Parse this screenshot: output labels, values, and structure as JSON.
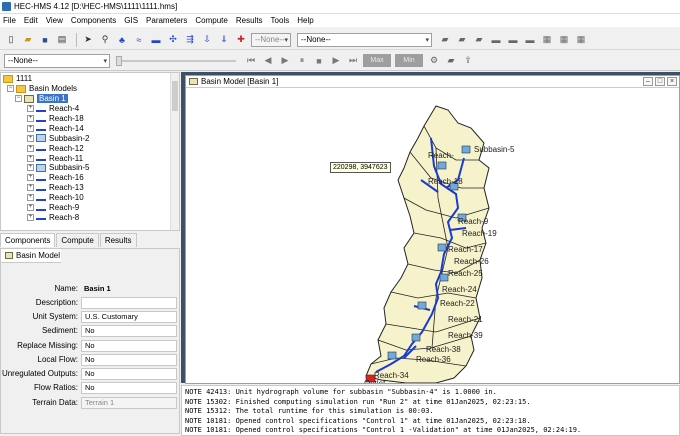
{
  "window": {
    "title": "HEC-HMS 4.12 [D:\\HEC-HMS\\1111\\1111.hms]"
  },
  "menu": [
    "File",
    "Edit",
    "View",
    "Components",
    "GIS",
    "Parameters",
    "Compute",
    "Results",
    "Tools",
    "Help"
  ],
  "toolbar": {
    "combo_none_small": "--None--",
    "combo_run": "--None--",
    "combo_time": "--None--",
    "max_label": "Max",
    "min_label": "Min"
  },
  "tree": {
    "root": "1111",
    "basin_models_label": "Basin Models",
    "selected_basin": "Basin 1",
    "items": [
      {
        "label": "Reach-4",
        "kind": "reach"
      },
      {
        "label": "Reach-18",
        "kind": "reach"
      },
      {
        "label": "Reach-14",
        "kind": "reach"
      },
      {
        "label": "Subbasin-2",
        "kind": "subbasin"
      },
      {
        "label": "Reach-12",
        "kind": "reach"
      },
      {
        "label": "Reach-11",
        "kind": "reach"
      },
      {
        "label": "Subbasin-5",
        "kind": "subbasin"
      },
      {
        "label": "Reach-16",
        "kind": "reach"
      },
      {
        "label": "Reach-13",
        "kind": "reach"
      },
      {
        "label": "Reach-10",
        "kind": "reach"
      },
      {
        "label": "Reach-9",
        "kind": "reach"
      },
      {
        "label": "Reach-8",
        "kind": "reach"
      }
    ]
  },
  "tabs": [
    "Components",
    "Compute",
    "Results"
  ],
  "properties": {
    "tab": "Basin Model",
    "rows": [
      {
        "label": "Name:",
        "value": "Basin 1",
        "style": "plain"
      },
      {
        "label": "Description:",
        "value": "",
        "style": "field"
      },
      {
        "label": "Unit System:",
        "value": "U.S. Customary",
        "style": "field"
      },
      {
        "label": "Sediment:",
        "value": "No",
        "style": "field"
      },
      {
        "label": "Replace Missing:",
        "value": "No",
        "style": "field"
      },
      {
        "label": "Local Flow:",
        "value": "No",
        "style": "field"
      },
      {
        "label": "Unregulated Outputs:",
        "value": "No",
        "style": "field"
      },
      {
        "label": "Flow Ratios:",
        "value": "No",
        "style": "field"
      },
      {
        "label": "Terrain Data:",
        "value": "Terrain 1",
        "style": "disabled"
      }
    ]
  },
  "map": {
    "title": "Basin Model [Basin 1]",
    "tooltip": "220298, 3947623",
    "labels": [
      "Reach-",
      "Subbasin-5",
      "Reach-18",
      "Reach-9",
      "Reach-19",
      "Reach-17",
      "Reach-26",
      "Reach-25",
      "Reach-24",
      "Reach-22",
      "Reach-21",
      "Reach-39",
      "Reach-38",
      "Reach-36",
      "Reach-34",
      "Outlet"
    ]
  },
  "log": [
    "NOTE 42413:  Unit hydrograph volume for subbasin \"Subbasin-4\" is 1.0000 in.",
    "NOTE 15302:  Finished computing simulation run \"Run 2\" at time 01Jan2025, 02:23:15.",
    "NOTE 15312:  The total runtime for this simulation is 00:03.",
    "NOTE 10181:  Opened control specifications \"Control 1\" at time 01Jan2025, 02:23:18.",
    "NOTE 10181:  Opened control specifications \"Control 1 -Validation\" at time 01Jan2025, 02:24:19."
  ]
}
